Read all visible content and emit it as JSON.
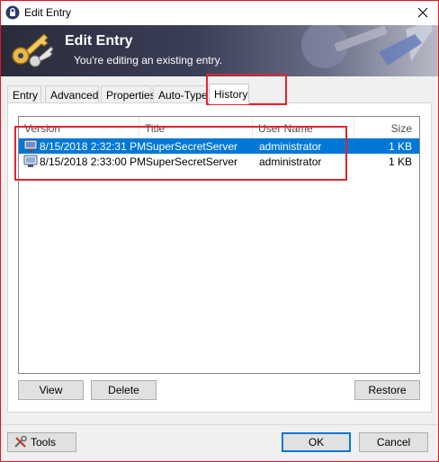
{
  "window": {
    "title": "Edit Entry"
  },
  "banner": {
    "title": "Edit Entry",
    "subtitle": "You're editing an existing entry."
  },
  "tabs": [
    {
      "label": "Entry"
    },
    {
      "label": "Advanced"
    },
    {
      "label": "Properties"
    },
    {
      "label": "Auto-Type"
    },
    {
      "label": "History",
      "active": true
    }
  ],
  "history": {
    "columns": [
      "Version",
      "Title",
      "User Name",
      "Size"
    ],
    "rows": [
      {
        "version": "8/15/2018 2:32:31 PM",
        "title": "SuperSecretServer",
        "user": "administrator",
        "size": "1 KB",
        "selected": true
      },
      {
        "version": "8/15/2018 2:33:00 PM",
        "title": "SuperSecretServer",
        "user": "administrator",
        "size": "1 KB",
        "selected": false
      }
    ],
    "buttons": {
      "view": "View",
      "delete": "Delete",
      "restore": "Restore"
    }
  },
  "footer": {
    "tools": "Tools",
    "ok": "OK",
    "cancel": "Cancel"
  },
  "colors": {
    "selection": "#0078d7",
    "highlight": "#e0242e",
    "banner_dark": "#2a2b3a"
  },
  "icons": [
    "app-lock-icon",
    "close-icon",
    "keys-icon",
    "entry-version-icon",
    "tools-icon"
  ]
}
